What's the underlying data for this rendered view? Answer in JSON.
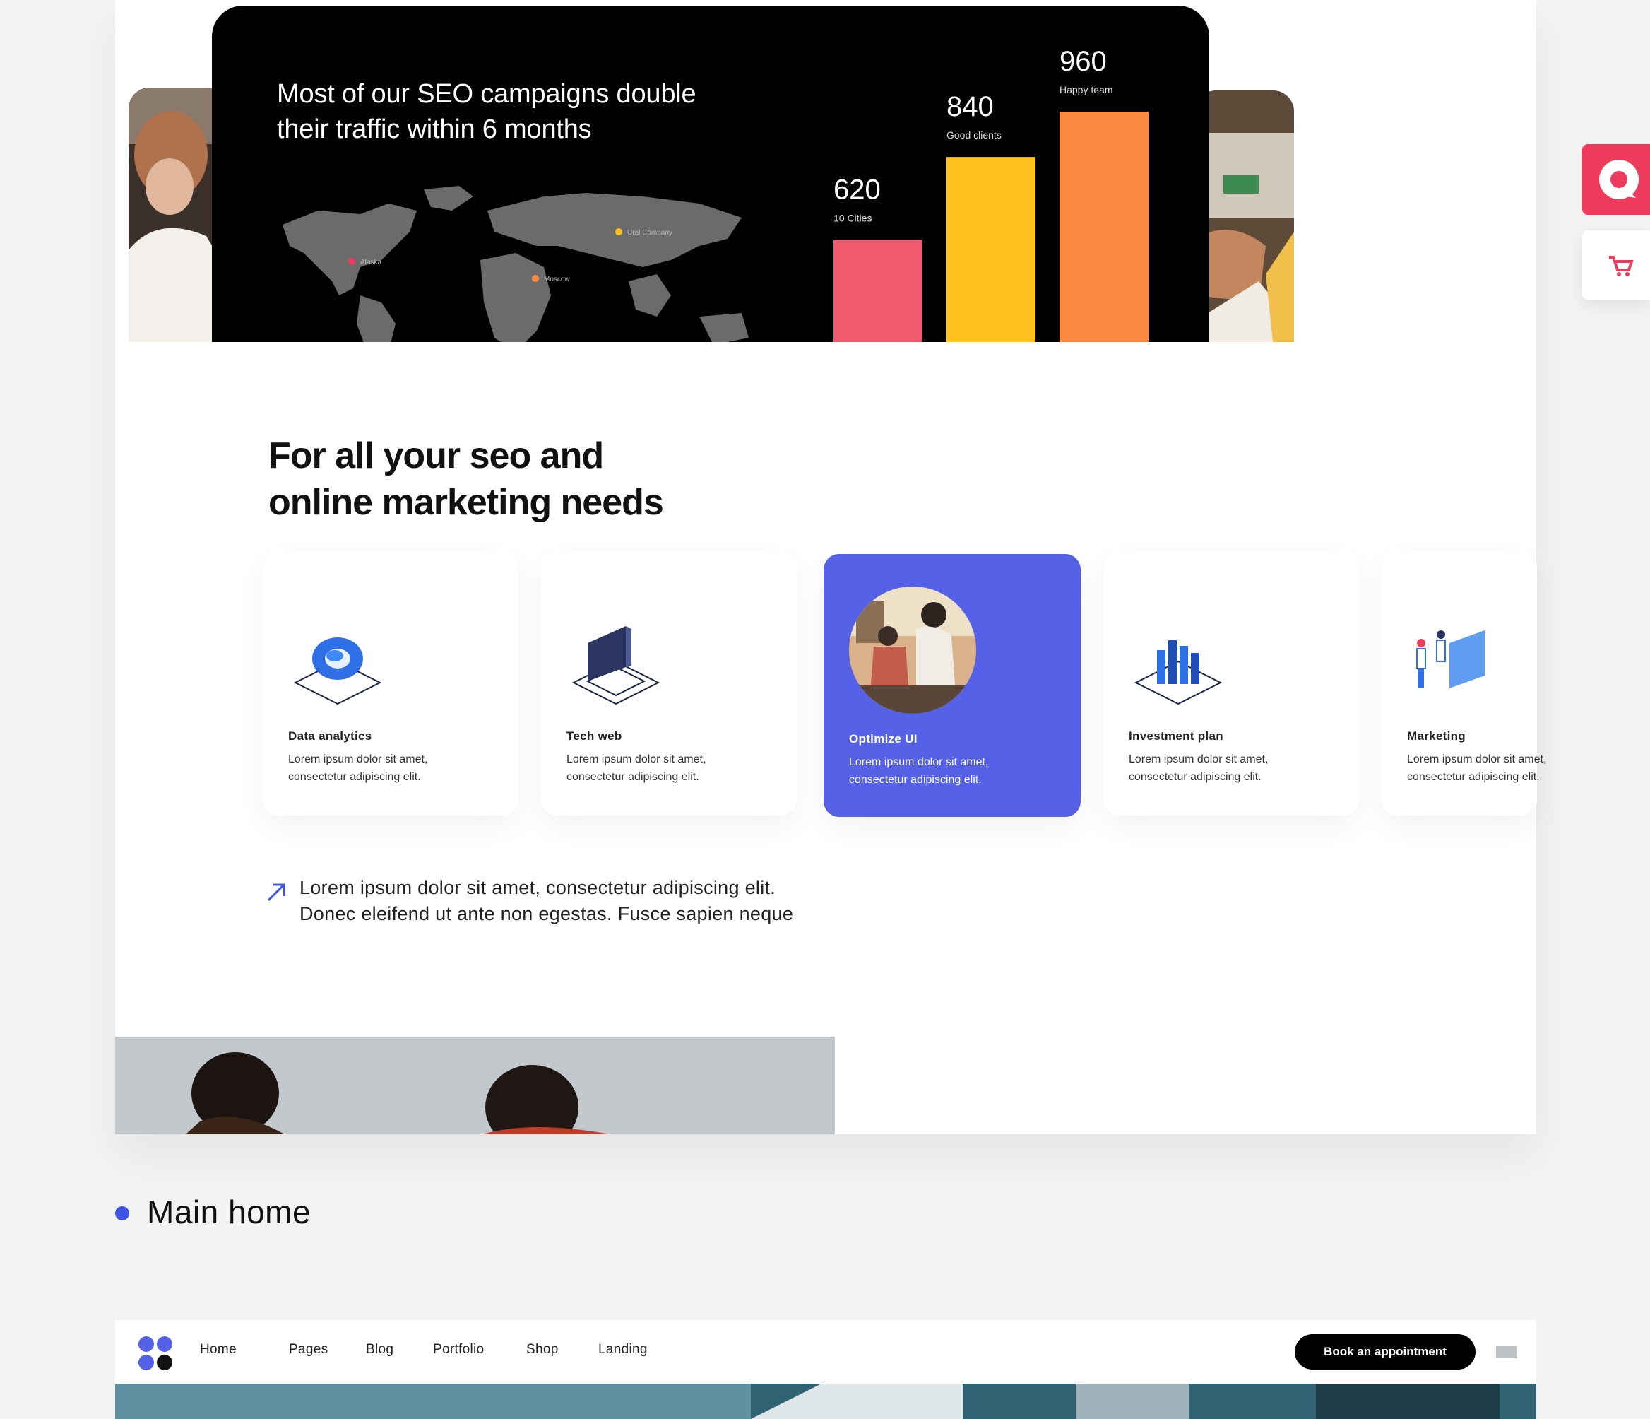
{
  "hero": {
    "headline": "Most of our SEO campaigns double\ntheir traffic within 6 months",
    "stats": [
      {
        "value": "620",
        "caption": "10 Cities",
        "color": "#ef5a6e"
      },
      {
        "value": "840",
        "caption": "Good clients",
        "color": "#fdc01d"
      },
      {
        "value": "960",
        "caption": "Happy team",
        "color": "#fb8b43"
      }
    ],
    "map_pins": [
      {
        "label": "Alaska",
        "color": "#ef3b5b"
      },
      {
        "label": "Moscow",
        "color": "#fb8b43"
      },
      {
        "label": "Ural Company",
        "color": "#fdc01d"
      }
    ]
  },
  "services": {
    "heading": "For all your seo and\nonline marketing needs",
    "cards": [
      {
        "title": "Data analytics",
        "desc": "Lorem ipsum dolor sit amet,\nconsectetur adipiscing elit.",
        "icon": "analytics-ring-icon",
        "active": false
      },
      {
        "title": "Tech web",
        "desc": "Lorem ipsum dolor sit amet,\nconsectetur adipiscing elit.",
        "icon": "laptop-icon",
        "active": false
      },
      {
        "title": "Optimize UI",
        "desc": "Lorem ipsum dolor sit amet,\nconsectetur adipiscing elit.",
        "icon": "team-photo",
        "active": true
      },
      {
        "title": "Investment plan",
        "desc": "Lorem ipsum dolor sit amet,\nconsectetur adipiscing elit.",
        "icon": "bar-chart-icon",
        "active": false
      },
      {
        "title": "Marketing",
        "desc": "Lorem ipsum dolor sit amet,\nconsectetur adipiscing elit.",
        "icon": "people-board-icon",
        "active": false
      }
    ],
    "body_text": "Lorem ipsum dolor sit amet, consectetur adipiscing elit.\nDonec eleifend ut ante non egestas. Fusce sapien neque"
  },
  "side_buttons": [
    {
      "icon": "chat-icon",
      "color": "#ef3b5b"
    },
    {
      "icon": "cart-icon",
      "color": "#ef3b5b"
    }
  ],
  "demo_label": "Main home",
  "preview_nav": {
    "items": [
      "Home",
      "Pages",
      "Blog",
      "Portfolio",
      "Shop",
      "Landing"
    ],
    "cta": "Book an appointment",
    "logo_icon": "four-dot-logo-icon",
    "menu_icon": "menu-icon"
  },
  "colors": {
    "accent": "#5561e6",
    "brand_dot": "#3d54e6",
    "side_button": "#ef3b5b"
  }
}
